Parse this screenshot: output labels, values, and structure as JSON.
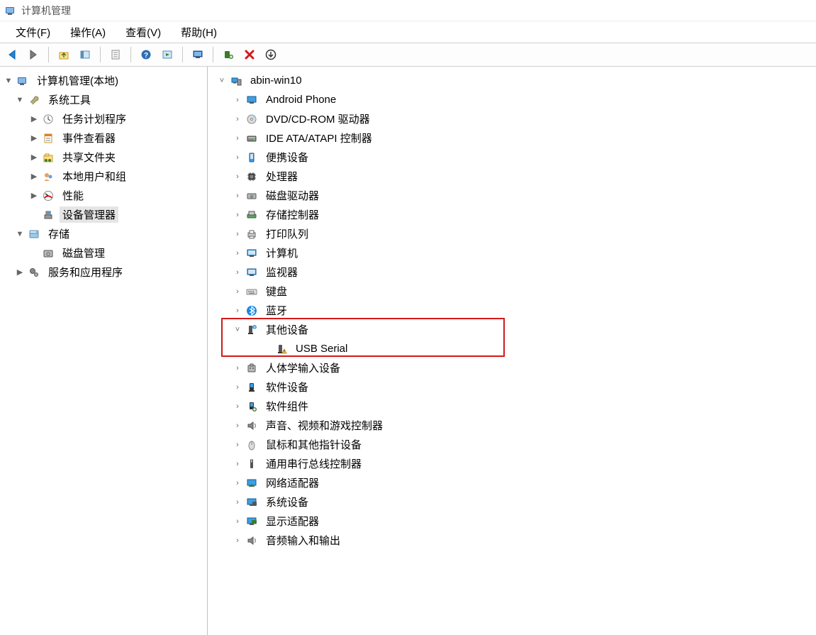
{
  "title": "计算机管理",
  "menu": {
    "file": "文件(F)",
    "action": "操作(A)",
    "view": "查看(V)",
    "help": "帮助(H)"
  },
  "leftTree": {
    "root": "计算机管理(本地)",
    "systemTools": "系统工具",
    "taskScheduler": "任务计划程序",
    "eventViewer": "事件查看器",
    "sharedFolders": "共享文件夹",
    "localUsers": "本地用户和组",
    "performance": "性能",
    "deviceManager": "设备管理器",
    "storage": "存储",
    "diskManagement": "磁盘管理",
    "services": "服务和应用程序"
  },
  "deviceTree": {
    "root": "abin-win10",
    "androidPhone": "Android Phone",
    "dvd": "DVD/CD-ROM 驱动器",
    "ide": "IDE ATA/ATAPI 控制器",
    "portable": "便携设备",
    "processors": "处理器",
    "diskDrives": "磁盘驱动器",
    "storageControllers": "存储控制器",
    "printQueues": "打印队列",
    "computer": "计算机",
    "monitors": "监视器",
    "keyboards": "键盘",
    "bluetooth": "蓝牙",
    "otherDevices": "其他设备",
    "usbSerial": "USB Serial",
    "hid": "人体学输入设备",
    "softwareDevices": "软件设备",
    "softwareComponents": "软件组件",
    "sound": "声音、视频和游戏控制器",
    "mouse": "鼠标和其他指针设备",
    "usbControllers": "通用串行总线控制器",
    "networkAdapters": "网络适配器",
    "systemDevices": "系统设备",
    "displayAdapters": "显示适配器",
    "audioIO": "音频输入和输出"
  }
}
